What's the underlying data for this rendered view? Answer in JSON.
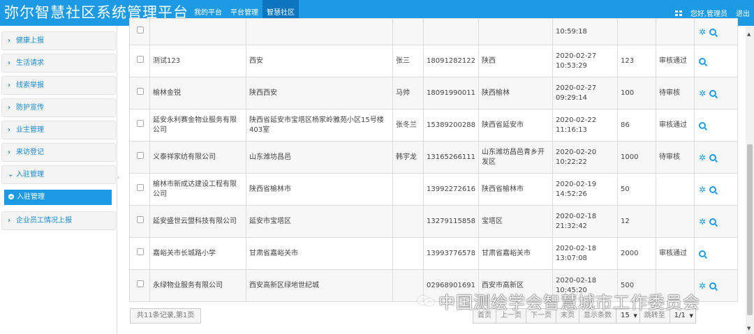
{
  "header": {
    "title": "弥尔智慧社区系统管理平台",
    "nav": [
      {
        "label": "我的平台",
        "active": false
      },
      {
        "label": "平台管理",
        "active": false
      },
      {
        "label": "智慧社区",
        "active": true
      }
    ],
    "user_greeting": "您好,管理员",
    "logout": "退出",
    "grid_icon": "grid-icon"
  },
  "sidebar": {
    "items": [
      {
        "label": "健康上报"
      },
      {
        "label": "生活请求"
      },
      {
        "label": "线索举报"
      },
      {
        "label": "防护宣传"
      },
      {
        "label": "业主管理"
      },
      {
        "label": "来访登记"
      },
      {
        "label": "入驻管理"
      },
      {
        "label": "企业员工情况上报"
      }
    ],
    "active_sub": "入驻管理"
  },
  "table": {
    "rows": [
      {
        "name": "",
        "address": "",
        "contact": "",
        "phone": "",
        "region": "",
        "date": "10:59:18",
        "count": "",
        "status": "",
        "ops": [
          "gear",
          "search"
        ]
      },
      {
        "name": "测试123",
        "address": "西安",
        "contact": "张三",
        "phone": "18091282122",
        "region": "陕西",
        "date": "2020-02-27 10:53:29",
        "count": "123",
        "status": "审核通过",
        "ops": [
          "search"
        ]
      },
      {
        "name": "榆林金锐",
        "address": "陕西西安",
        "contact": "马帅",
        "phone": "18091990011",
        "region": "陕西榆林",
        "date": "2020-02-27 09:29:14",
        "count": "100",
        "status": "待审核",
        "ops": [
          "gear",
          "search"
        ]
      },
      {
        "name": "延安永利赛金物业服务有限公司",
        "address": "陕西省延安市宝塔区杨家岭雅苑小区15号楼403室",
        "contact": "张冬兰",
        "phone": "15389200288",
        "region": "陕西省延安市",
        "date": "2020-02-22 11:16:13",
        "count": "86",
        "status": "审核通过",
        "ops": [
          "search"
        ]
      },
      {
        "name": "义泰祥家纺有限公司",
        "address": "山东潍坊昌邑",
        "contact": "韩宇龙",
        "phone": "13165266111",
        "region": "山东潍坊昌邑青乡开发区",
        "date": "2020-02-20 10:22:22",
        "count": "1000",
        "status": "待审核",
        "ops": [
          "gear",
          "search"
        ]
      },
      {
        "name": "榆林市新成达建设工程有限公司",
        "address": "陕西省榆林市",
        "contact": "",
        "phone": "13992272616",
        "region": "陕西省榆林市",
        "date": "2020-02-19 14:52:26",
        "count": "50",
        "status": "",
        "ops": [
          "gear",
          "search"
        ]
      },
      {
        "name": "延安盛世云盟科技有限公司",
        "address": "延安市宝塔区",
        "contact": "",
        "phone": "13279115858",
        "region": "宝塔区",
        "date": "2020-02-18 21:32:42",
        "count": "12",
        "status": "",
        "ops": [
          "gear",
          "search"
        ]
      },
      {
        "name": "嘉峪关市长城路小学",
        "address": "甘肃省嘉峪关市",
        "contact": "",
        "phone": "13993776578",
        "region": "甘肃省嘉峪关市",
        "date": "2020-02-18 13:07:08",
        "count": "2000",
        "status": "审核通过",
        "ops": [
          "search"
        ]
      },
      {
        "name": "永绿物业服务有限公司",
        "address": "西安高新区绿地世纪城",
        "contact": "",
        "phone": "02968901691",
        "region": "西安市高新区",
        "date": "2020-02-18 10:45:20",
        "count": "500",
        "status": "",
        "ops": [
          "gear",
          "search"
        ]
      }
    ]
  },
  "footer": {
    "records": "共11条记录,第1页",
    "pager": {
      "first": "首页",
      "prev": "上一页",
      "next": "下一页",
      "last": "末页",
      "page_size_label": "显示条数",
      "page_size": "15",
      "jump_label": "跳转至",
      "page_value": "1/1"
    }
  },
  "watermark": "中国测绘学会智慧城市工作委员会",
  "colors": {
    "primary": "#1c9ae3",
    "nav_active": "#0b76bf"
  }
}
